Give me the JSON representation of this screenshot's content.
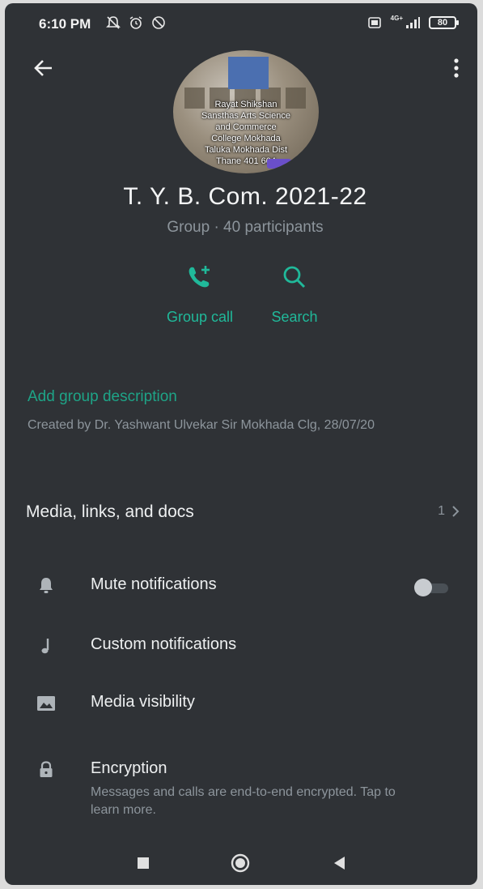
{
  "status_bar": {
    "time": "6:10 PM",
    "battery": "80",
    "network": "4G+"
  },
  "header": {
    "back_icon": "arrow-left-icon",
    "menu_icon": "more-vertical-icon"
  },
  "avatar": {
    "caption_lines": [
      "Rayat Shikshan",
      "Sansthas Arts Science",
      "and Commerce",
      "College Mokhada",
      "Taluka Mokhada Dist",
      "Thane 401 604"
    ]
  },
  "group": {
    "title": "T. Y. B. Com. 2021-22",
    "subtitle": "Group · 40 participants"
  },
  "actions": {
    "group_call": "Group call",
    "search": "Search"
  },
  "description": {
    "add_label": "Add group description",
    "created_by": "Created by Dr. Yashwant Ulvekar Sir Mokhada Clg, 28/07/20"
  },
  "media": {
    "label": "Media, links, and docs",
    "count": "1"
  },
  "settings": {
    "mute": {
      "label": "Mute notifications",
      "icon": "bell-icon",
      "enabled": false
    },
    "custom": {
      "label": "Custom notifications",
      "icon": "music-note-icon"
    },
    "visibility": {
      "label": "Media visibility",
      "icon": "image-icon"
    },
    "encryption": {
      "label": "Encryption",
      "icon": "lock-icon",
      "description": "Messages and calls are end-to-end encrypted. Tap to learn more."
    }
  },
  "colors": {
    "background": "#2f3236",
    "accent": "#20b99a",
    "secondary_text": "#8d959c"
  }
}
